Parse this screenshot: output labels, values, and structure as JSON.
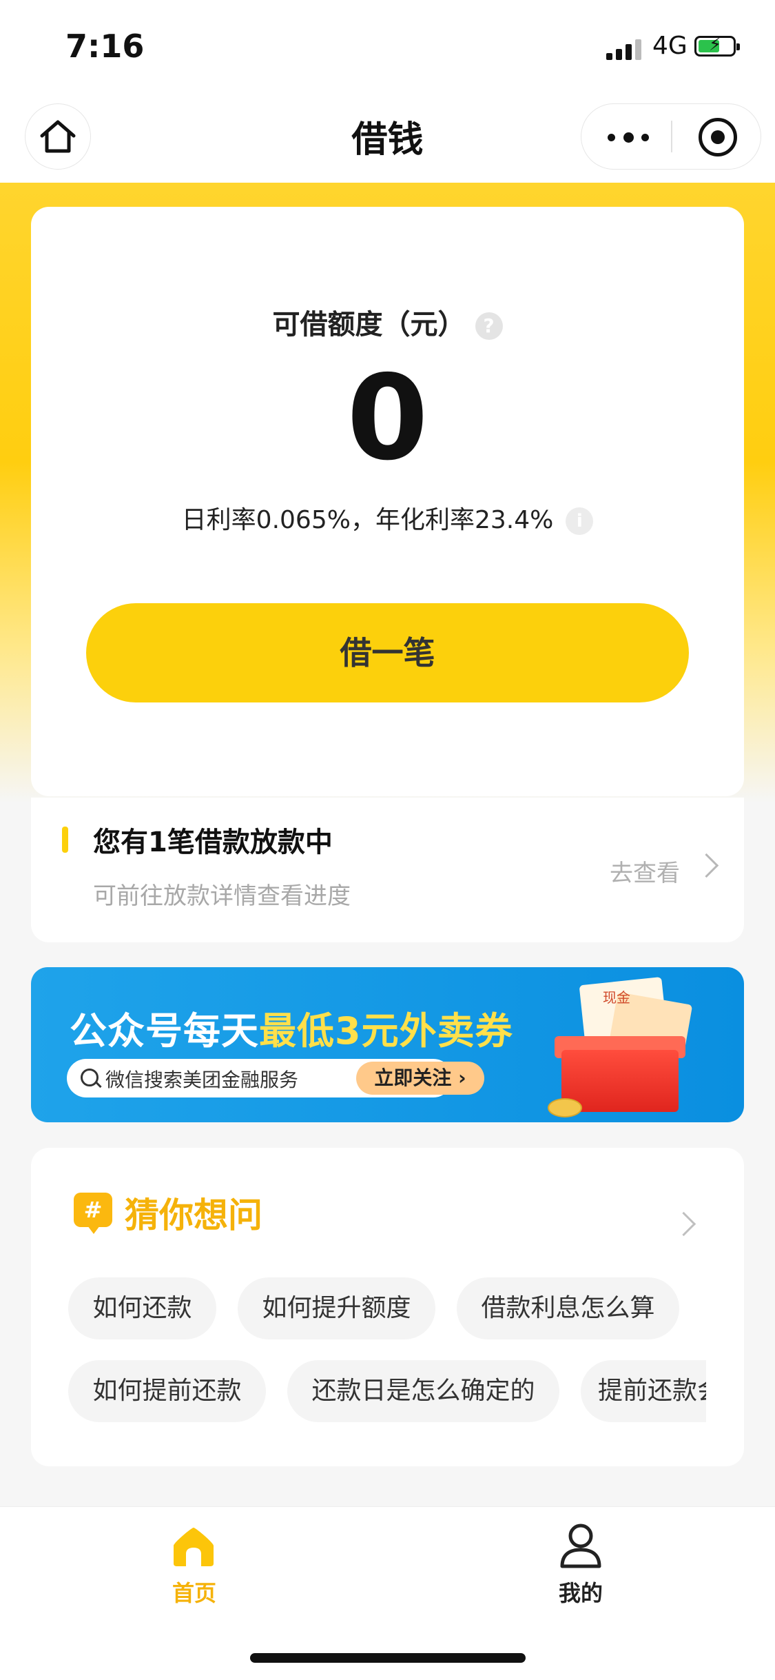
{
  "status_bar": {
    "time": "7:16",
    "network": "4G"
  },
  "nav": {
    "title": "借钱"
  },
  "credit": {
    "label": "可借额度（元）",
    "help": "?",
    "value": "0",
    "rate_text": "日利率0.065%，年化利率23.4%",
    "info": "i",
    "borrow_button": "借一笔"
  },
  "loan_status": {
    "title": "您有1笔借款放款中",
    "subtitle": "可前往放款详情查看进度",
    "link": "去查看"
  },
  "banner": {
    "title_prefix": "公众号每天",
    "title_highlight": "最低3元外卖券",
    "search_text": "微信搜索美团金融服务",
    "follow_button": "立即关注 ›",
    "gift_text": "现金"
  },
  "faq": {
    "icon": "#",
    "title": "猜你想问",
    "chips": [
      "如何还款",
      "如何提升额度",
      "借款利息怎么算",
      "如何提前还款",
      "还款日是怎么确定的",
      "提前还款会"
    ]
  },
  "tabbar": {
    "items": [
      {
        "label": "首页",
        "active": true
      },
      {
        "label": "我的",
        "active": false
      }
    ]
  },
  "colors": {
    "brand_yellow": "#fcd00c",
    "accent_orange": "#f5b20a",
    "banner_blue": "#1fa3ea"
  }
}
